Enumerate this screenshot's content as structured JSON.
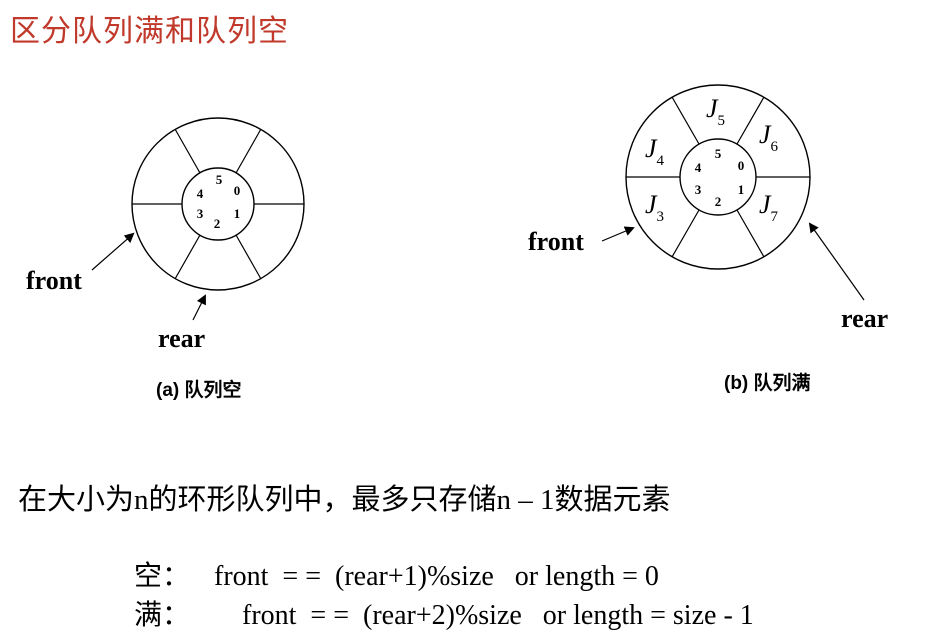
{
  "title": "区分队列满和队列空",
  "diagram_a": {
    "slots": [
      "5",
      "0",
      "1",
      "2",
      "3",
      "4"
    ],
    "front_label": "front",
    "rear_label": "rear",
    "caption": "(a) 队列空"
  },
  "diagram_b": {
    "slots": [
      "5",
      "0",
      "1",
      "2",
      "3",
      "4"
    ],
    "elements": [
      {
        "base": "J",
        "sub": "5"
      },
      {
        "base": "J",
        "sub": "6"
      },
      {
        "base": "J",
        "sub": "7"
      },
      {
        "base": "J",
        "sub": "3"
      },
      {
        "base": "J",
        "sub": "4"
      }
    ],
    "front_label": "front",
    "rear_label": "rear",
    "caption": "(b) 队列满"
  },
  "description": "在大小为n的环形队列中，最多只存储n – 1数据元素",
  "conditions": {
    "empty_label": "空：",
    "empty_expr": "front  = =  (rear+1)%size   or length = 0",
    "full_label": "满：",
    "full_expr": "    front  = =  (rear+2)%size   or length = size - 1"
  }
}
